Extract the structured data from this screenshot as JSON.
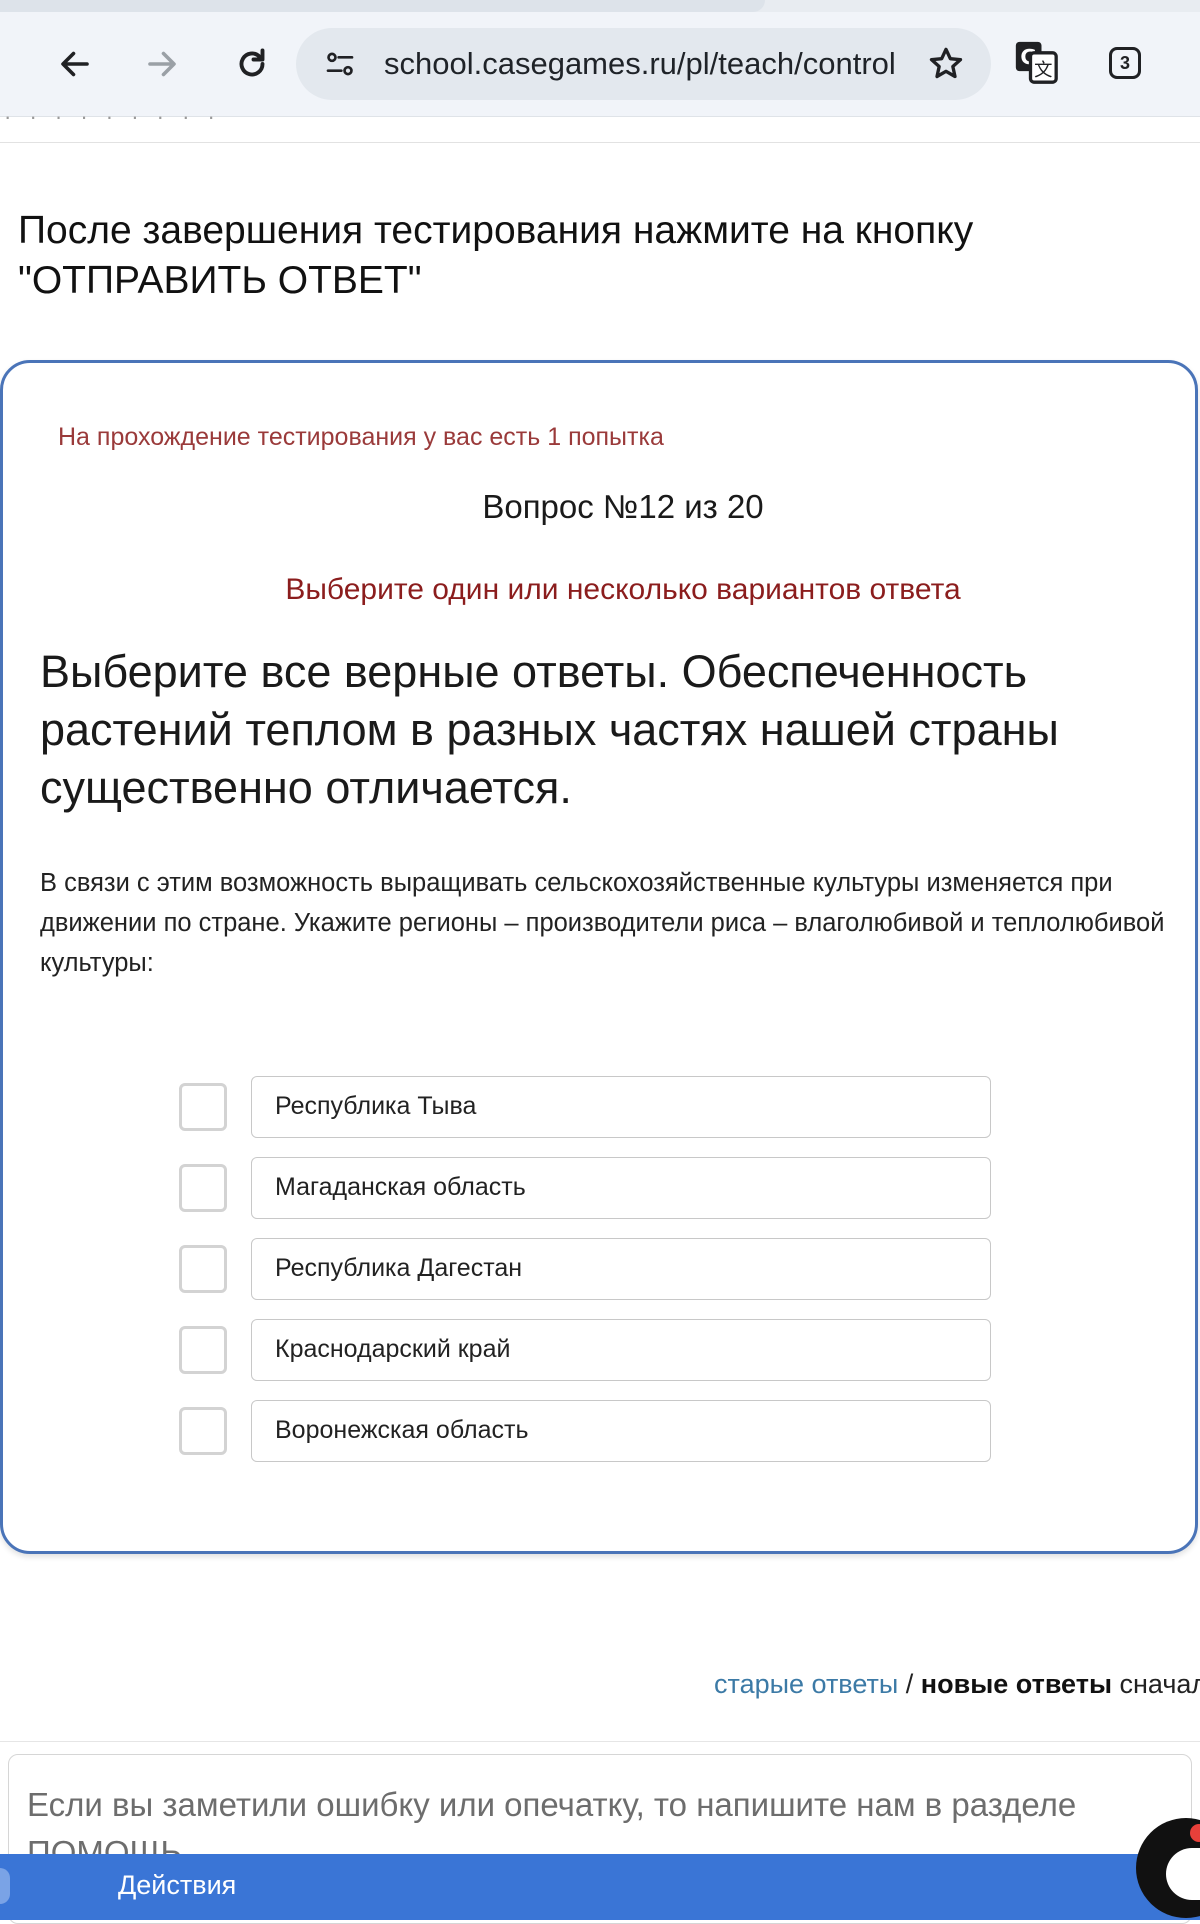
{
  "browser": {
    "url": "school.casegames.ru/pl/teach/control",
    "tabs_count": "3",
    "icons": {
      "back": "arrow-left-icon",
      "forward": "arrow-right-icon",
      "reload": "reload-icon",
      "site_info": "site-settings-icon",
      "bookmark": "star-icon",
      "translate": "translate-icon"
    }
  },
  "page": {
    "intro": "После завершения тестирования нажмите на кнопку \"ОТПРАВИТЬ ОТВЕТ\"",
    "quiz": {
      "attempts": "На прохождение тестирования у вас есть 1 попытка",
      "question_number": "Вопрос №12 из 20",
      "instruction": "Выберите один или несколько вариантов ответа",
      "question": "Выберите все верные ответы. Обеспеченность растений теплом в разных частях нашей страны существенно отличается.",
      "description": "В связи с этим возможность выращивать сельскохозяйственные культуры изменяется при движении по стране. Укажите регионы – производители риса – влаголюбивой и теплолюбивой культуры:",
      "options": [
        {
          "label": "Республика Тыва",
          "checked": false
        },
        {
          "label": "Магаданская область",
          "checked": false
        },
        {
          "label": "Республика Дагестан",
          "checked": false
        },
        {
          "label": "Краснодарский край",
          "checked": false
        },
        {
          "label": "Воронежская область",
          "checked": false
        }
      ]
    },
    "comments": {
      "sort_old": "старые ответы",
      "sort_separator": "/",
      "sort_new": "новые ответы",
      "sort_suffix": "сначала",
      "placeholder": "Если вы заметили ошибку или опечатку, то напишите нам в разделе ПОМОЩЬ"
    },
    "footer": {
      "actions_label": "Действия"
    }
  },
  "colors": {
    "card_border": "#4a74b8",
    "attempts_text": "#9a3a3a",
    "instruction_text": "#8b1d1d",
    "link": "#3c7aa6",
    "actions_bar": "#3a75d6"
  }
}
